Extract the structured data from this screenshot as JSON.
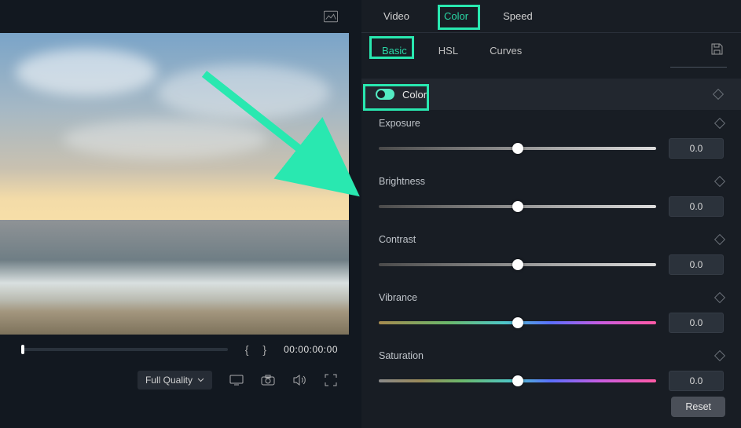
{
  "top_tabs": {
    "video": "Video",
    "color": "Color",
    "speed": "Speed"
  },
  "sub_tabs": {
    "basic": "Basic",
    "hsl": "HSL",
    "curves": "Curves"
  },
  "color_section": {
    "label": "Color"
  },
  "params": {
    "exposure": {
      "name": "Exposure",
      "value": "0.0"
    },
    "brightness": {
      "name": "Brightness",
      "value": "0.0"
    },
    "contrast": {
      "name": "Contrast",
      "value": "0.0"
    },
    "vibrance": {
      "name": "Vibrance",
      "value": "0.0"
    },
    "saturation": {
      "name": "Saturation",
      "value": "0.0"
    }
  },
  "reset": "Reset",
  "playback": {
    "quality": "Full Quality",
    "timecode": "00:00:00:00",
    "bracket_open": "{",
    "bracket_close": "}"
  }
}
